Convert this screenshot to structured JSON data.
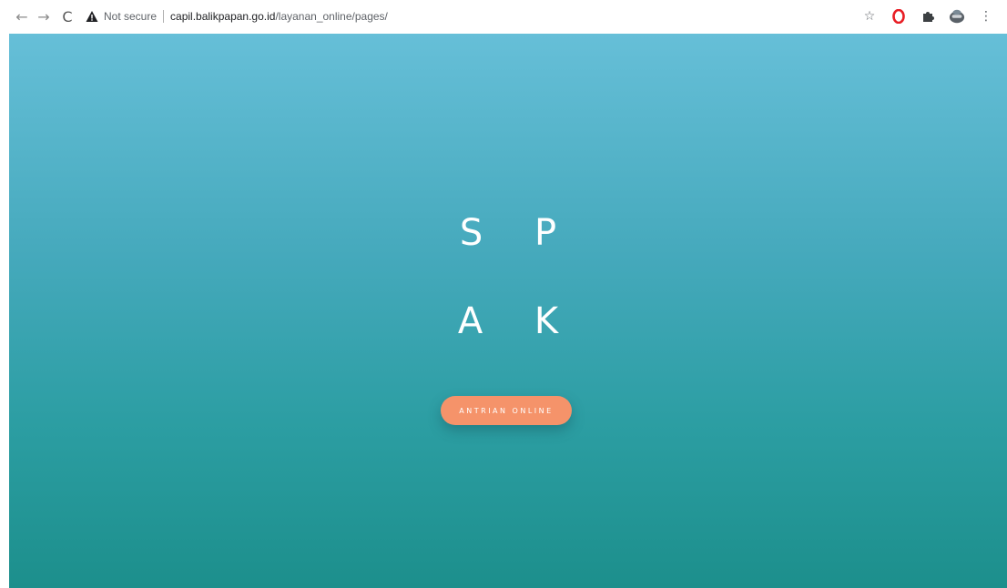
{
  "browser": {
    "back_icon": "arrow-left-icon",
    "back_glyph": "←",
    "forward_icon": "arrow-right-icon",
    "forward_glyph": "→",
    "reload_icon": "reload-icon",
    "reload_glyph": "C",
    "security_icon": "warning-triangle-icon",
    "security_text": "Not secure",
    "url_host": "capil.balikpapan.go.id",
    "url_path": "/layanan_online/pages/",
    "bookmark_glyph": "☆",
    "menu_glyph": "⋮",
    "warning_color": "#202124",
    "opera_color": "#e81e25"
  },
  "page": {
    "hero_line_1": "S P",
    "hero_line_2": "A K",
    "cta_label": "ANTRIAN ONLINE",
    "accent_color": "#f5936a",
    "gradient_top": "#66bfd8",
    "gradient_bottom": "#1c8f8c"
  }
}
